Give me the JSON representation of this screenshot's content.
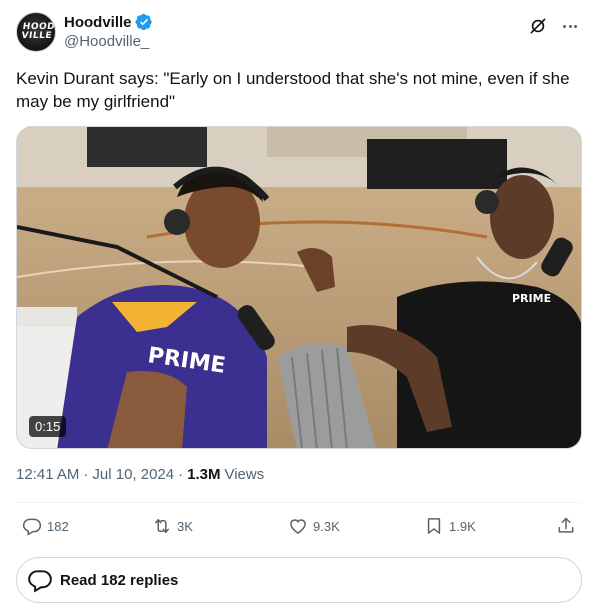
{
  "author": {
    "display_name": "Hoodville",
    "handle": "@Hoodville_",
    "avatar_text": "HOOD VILLE",
    "verified_icon": "verified-badge-icon",
    "verified_color": "#1d9bf0"
  },
  "tweet": {
    "text": "Kevin Durant says: \"Early on I understood that she's not mine, even if she may be my girlfriend\""
  },
  "media": {
    "duration": "0:15",
    "jersey_text": "PRIME",
    "shirt_text": "PRIME"
  },
  "meta": {
    "time": "12:41 AM",
    "date": "Jul 10, 2024",
    "views_count": "1.3M",
    "views_label": "Views"
  },
  "actions": {
    "replies": "182",
    "reposts": "3K",
    "likes": "9.3K",
    "bookmarks": "1.9K"
  },
  "read_replies_label": "Read 182 replies",
  "colors": {
    "text": "#0f1419",
    "secondary": "#536471",
    "border": "#cfd9de"
  }
}
